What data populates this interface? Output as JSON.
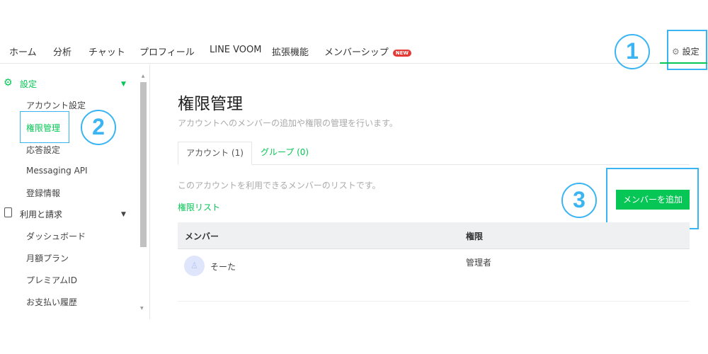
{
  "nav": {
    "items": [
      "ホーム",
      "分析",
      "チャット",
      "プロフィール",
      "LINE VOOM",
      "拡張機能",
      "メンバーシップ"
    ],
    "new_badge": "NEW",
    "settings": "設定"
  },
  "annotations": {
    "one": "1",
    "two": "2",
    "three": "3"
  },
  "sidebar": {
    "section1": "設定",
    "section1_items": [
      "アカウント設定",
      "権限管理",
      "応答設定",
      "Messaging API",
      "登録情報"
    ],
    "section2": "利用と請求",
    "section2_items": [
      "ダッシュボード",
      "月額プラン",
      "プレミアムID",
      "お支払い履歴"
    ]
  },
  "main": {
    "title": "権限管理",
    "subtitle": "アカウントへのメンバーの追加や権限の管理を行います。",
    "tabs": [
      "アカウント (1)",
      "グループ (0)"
    ],
    "description": "このアカウントを利用できるメンバーのリストです。",
    "list_link": "権限リスト",
    "add_button": "メンバーを追加",
    "table": {
      "headers": [
        "メンバー",
        "権限"
      ],
      "rows": [
        {
          "member": "そーた",
          "role": "管理者"
        }
      ]
    }
  },
  "colors": {
    "accent": "#06c755",
    "annotation": "#3ab4f2",
    "badge": "#e53935"
  }
}
